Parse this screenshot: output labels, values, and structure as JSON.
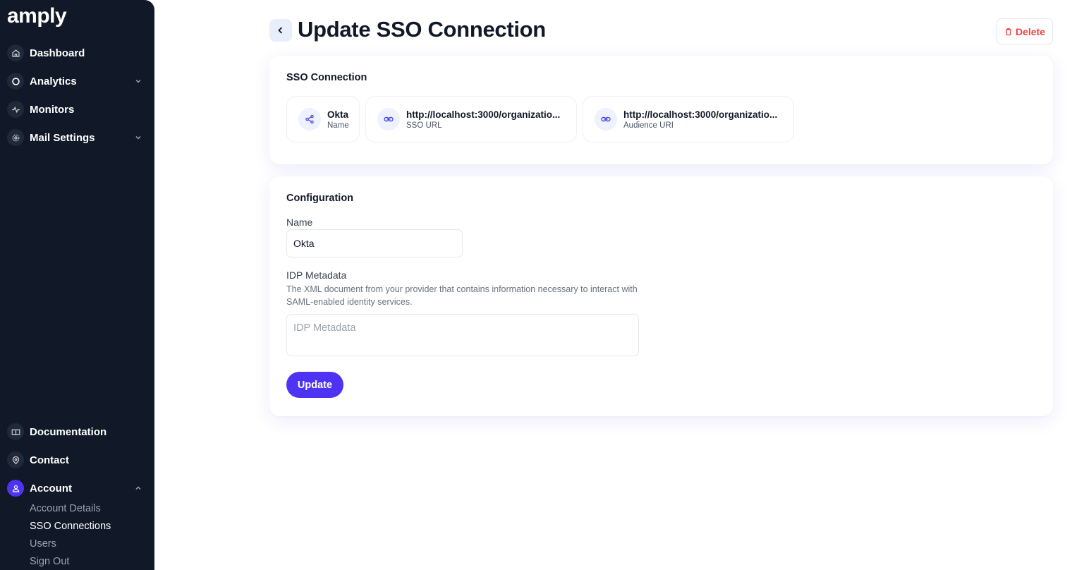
{
  "app": {
    "logo": "amply"
  },
  "sidebar": {
    "items": [
      {
        "label": "Dashboard",
        "icon": "home-icon"
      },
      {
        "label": "Analytics",
        "icon": "circle-icon",
        "expandable": true
      },
      {
        "label": "Monitors",
        "icon": "activity-icon"
      },
      {
        "label": "Mail Settings",
        "icon": "gear-icon",
        "expandable": true
      }
    ],
    "bottom": [
      {
        "label": "Documentation",
        "icon": "book-icon"
      },
      {
        "label": "Contact",
        "icon": "help-icon"
      },
      {
        "label": "Account",
        "icon": "user-icon",
        "expanded": true
      }
    ],
    "account_sub": [
      "Account Details",
      "SSO Connections",
      "Users",
      "Sign Out"
    ],
    "active_sub": "SSO Connections"
  },
  "header": {
    "title": "Update SSO Connection",
    "delete_label": "Delete"
  },
  "sso_card": {
    "title": "SSO Connection",
    "pills": [
      {
        "value": "Okta",
        "label": "Name",
        "icon": "share-icon"
      },
      {
        "value": "http://localhost:3000/organizatio...",
        "label": "SSO URL",
        "icon": "link-icon"
      },
      {
        "value": "http://localhost:3000/organizatio...",
        "label": "Audience URI",
        "icon": "link-icon"
      }
    ]
  },
  "config_card": {
    "title": "Configuration",
    "name_label": "Name",
    "name_value": "Okta",
    "idp_label": "IDP Metadata",
    "idp_help": "The XML document from your provider that contains information necessary to interact with SAML-enabled identity services.",
    "idp_placeholder": "IDP Metadata",
    "idp_value": "",
    "update_label": "Update"
  },
  "colors": {
    "sidebar_bg": "#111827",
    "accent": "#4f33f5",
    "danger": "#ef4444"
  }
}
